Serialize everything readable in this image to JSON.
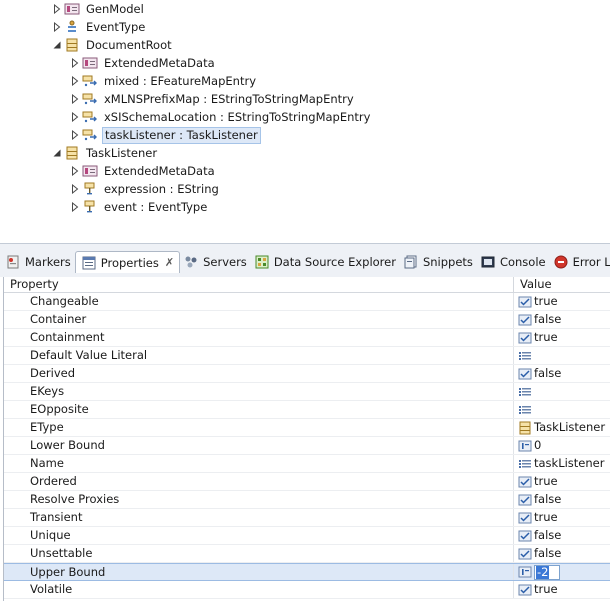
{
  "tree": {
    "nodes": [
      {
        "name": "tree-node-genmodel",
        "label": "GenModel",
        "icon": "annotation-icon",
        "indent": 1,
        "arrow": "collapsed"
      },
      {
        "name": "tree-node-eventtype",
        "label": "EventType",
        "icon": "enum-icon",
        "indent": 1,
        "arrow": "collapsed"
      },
      {
        "name": "tree-node-documentroot",
        "label": "DocumentRoot",
        "icon": "class-icon",
        "indent": 1,
        "arrow": "expanded"
      },
      {
        "name": "tree-node-extendedmetadata",
        "label": "ExtendedMetaData",
        "icon": "annotation-icon",
        "indent": 2,
        "arrow": "collapsed"
      },
      {
        "name": "tree-node-mixed",
        "label": "mixed : EFeatureMapEntry",
        "icon": "reference-icon",
        "indent": 2,
        "arrow": "collapsed"
      },
      {
        "name": "tree-node-xmlnsprefixmap",
        "label": "xMLNSPrefixMap : EStringToStringMapEntry",
        "icon": "reference-icon",
        "indent": 2,
        "arrow": "collapsed"
      },
      {
        "name": "tree-node-xsischemalocation",
        "label": "xSISchemaLocation : EStringToStringMapEntry",
        "icon": "reference-icon",
        "indent": 2,
        "arrow": "collapsed"
      },
      {
        "name": "tree-node-tasklistener-ref",
        "label": "taskListener : TaskListener",
        "icon": "reference-icon",
        "indent": 2,
        "arrow": "collapsed",
        "selected": true
      },
      {
        "name": "tree-node-tasklistener",
        "label": "TaskListener",
        "icon": "class-icon",
        "indent": 1,
        "arrow": "expanded"
      },
      {
        "name": "tree-node-extendedmetadata-2",
        "label": "ExtendedMetaData",
        "icon": "annotation-icon",
        "indent": 2,
        "arrow": "collapsed"
      },
      {
        "name": "tree-node-expression",
        "label": "expression : EString",
        "icon": "attribute-icon",
        "indent": 2,
        "arrow": "collapsed"
      },
      {
        "name": "tree-node-event",
        "label": "event : EventType",
        "icon": "attribute-icon",
        "indent": 2,
        "arrow": "collapsed"
      }
    ]
  },
  "tabs": [
    {
      "name": "tab-markers",
      "label": "Markers",
      "icon": "markers-icon"
    },
    {
      "name": "tab-properties",
      "label": "Properties",
      "icon": "properties-icon",
      "active": true,
      "close": "✗"
    },
    {
      "name": "tab-servers",
      "label": "Servers",
      "icon": "servers-icon"
    },
    {
      "name": "tab-data-source-explorer",
      "label": "Data Source Explorer",
      "icon": "data-source-icon"
    },
    {
      "name": "tab-snippets",
      "label": "Snippets",
      "icon": "snippets-icon"
    },
    {
      "name": "tab-console",
      "label": "Console",
      "icon": "console-icon"
    },
    {
      "name": "tab-error-log",
      "label": "Error Log",
      "icon": "error-log-icon"
    }
  ],
  "properties": {
    "header": {
      "property": "Property",
      "value": "Value"
    },
    "rows": [
      {
        "name": "Changeable",
        "value": "true",
        "icon": "boolean-icon"
      },
      {
        "name": "Container",
        "value": "false",
        "icon": "boolean-icon"
      },
      {
        "name": "Containment",
        "value": "true",
        "icon": "boolean-icon"
      },
      {
        "name": "Default Value Literal",
        "value": "",
        "icon": "list-icon"
      },
      {
        "name": "Derived",
        "value": "false",
        "icon": "boolean-icon"
      },
      {
        "name": "EKeys",
        "value": "",
        "icon": "list-icon"
      },
      {
        "name": "EOpposite",
        "value": "",
        "icon": "list-icon"
      },
      {
        "name": "EType",
        "value": "TaskListener",
        "icon": "class-icon"
      },
      {
        "name": "Lower Bound",
        "value": "0",
        "icon": "number-icon"
      },
      {
        "name": "Name",
        "value": "taskListener",
        "icon": "list-icon"
      },
      {
        "name": "Ordered",
        "value": "true",
        "icon": "boolean-icon"
      },
      {
        "name": "Resolve Proxies",
        "value": "false",
        "icon": "boolean-icon"
      },
      {
        "name": "Transient",
        "value": "true",
        "icon": "boolean-icon"
      },
      {
        "name": "Unique",
        "value": "false",
        "icon": "boolean-icon"
      },
      {
        "name": "Unsettable",
        "value": "false",
        "icon": "boolean-icon"
      },
      {
        "name": "Upper Bound",
        "value": "-2",
        "icon": "number-icon",
        "selected": true,
        "editing": true
      },
      {
        "name": "Volatile",
        "value": "true",
        "icon": "boolean-icon"
      }
    ]
  },
  "colors": {
    "selection": "#dde8f7",
    "edit_highlight": "#3b78d6",
    "tabbar_bg": "#eef1f6"
  }
}
